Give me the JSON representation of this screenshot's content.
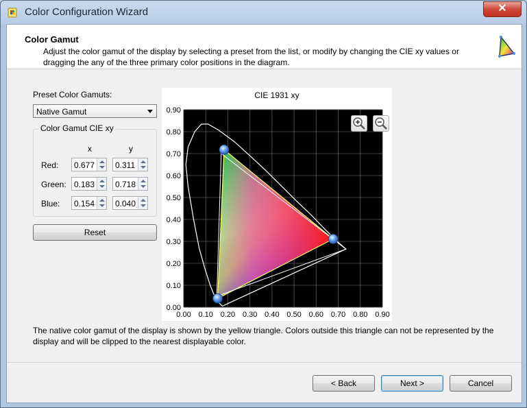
{
  "window": {
    "title": "Color Configuration Wizard",
    "close_label": "✕"
  },
  "header": {
    "title": "Color Gamut",
    "description": "Adjust the color gamut of the display by selecting a preset from the list, or modify by changing the CIE xy values or dragging the any of the three primary color positions in the diagram."
  },
  "preset": {
    "label": "Preset Color Gamuts:",
    "selected": "Native Gamut"
  },
  "gamut_group": {
    "title": "Color Gamut CIE xy",
    "x_header": "x",
    "y_header": "y",
    "rows": [
      {
        "label": "Red:",
        "x": "0.677",
        "y": "0.311"
      },
      {
        "label": "Green:",
        "x": "0.183",
        "y": "0.718"
      },
      {
        "label": "Blue:",
        "x": "0.154",
        "y": "0.040"
      }
    ]
  },
  "reset_label": "Reset",
  "footnote": "The native color gamut of the display is shown by the yellow triangle. Colors outside this triangle can not be represented by the display and will be clipped to the nearest displayable color.",
  "buttons": {
    "back": "< Back",
    "next": "Next >",
    "cancel": "Cancel"
  },
  "chart_data": {
    "type": "scatter",
    "title": "CIE 1931 xy",
    "xlim": [
      0,
      0.9
    ],
    "ylim": [
      0,
      0.9
    ],
    "x_ticks": [
      "0.00",
      "0.10",
      "0.20",
      "0.30",
      "0.40",
      "0.50",
      "0.60",
      "0.70",
      "0.80",
      "0.90"
    ],
    "y_ticks": [
      "0.00",
      "0.10",
      "0.20",
      "0.30",
      "0.40",
      "0.50",
      "0.60",
      "0.70",
      "0.80",
      "0.90"
    ],
    "grid": true,
    "primaries": [
      {
        "name": "red",
        "x": 0.677,
        "y": 0.311
      },
      {
        "name": "green",
        "x": 0.183,
        "y": 0.718
      },
      {
        "name": "blue",
        "x": 0.154,
        "y": 0.04
      }
    ],
    "reference_triangle": [
      [
        0.735,
        0.265
      ],
      [
        0.17,
        0.7
      ],
      [
        0.15,
        0.05
      ]
    ],
    "spectral_locus": [
      [
        0.175,
        0.005
      ],
      [
        0.16,
        0.02
      ],
      [
        0.14,
        0.05
      ],
      [
        0.12,
        0.1
      ],
      [
        0.095,
        0.18
      ],
      [
        0.07,
        0.27
      ],
      [
        0.045,
        0.4
      ],
      [
        0.02,
        0.55
      ],
      [
        0.01,
        0.65
      ],
      [
        0.02,
        0.73
      ],
      [
        0.05,
        0.8
      ],
      [
        0.08,
        0.834
      ],
      [
        0.11,
        0.835
      ],
      [
        0.16,
        0.806
      ],
      [
        0.23,
        0.754
      ],
      [
        0.3,
        0.69
      ],
      [
        0.37,
        0.625
      ],
      [
        0.44,
        0.555
      ],
      [
        0.51,
        0.485
      ],
      [
        0.58,
        0.418
      ],
      [
        0.64,
        0.355
      ],
      [
        0.69,
        0.305
      ],
      [
        0.735,
        0.265
      ]
    ],
    "colors": {
      "background": "#000000",
      "grid": "#4a4a4a",
      "locus": "#ffffff",
      "gamut_edge": "#ffff66",
      "handle": "#4a8fe0"
    }
  }
}
